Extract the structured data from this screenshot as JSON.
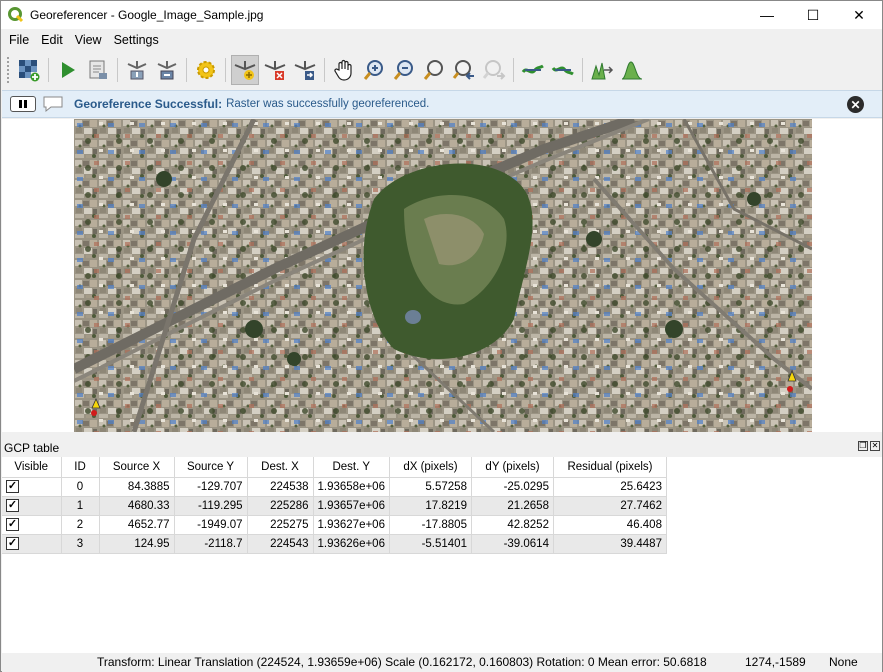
{
  "window": {
    "title": "Georeferencer - Google_Image_Sample.jpg",
    "controls": {
      "minimize": "—",
      "maximize": "☐",
      "close": "✕"
    }
  },
  "menu": [
    "File",
    "Edit",
    "View",
    "Settings"
  ],
  "toolbar": {
    "buttons": [
      "open-raster-icon",
      "start-georeferencing-icon",
      "generate-gdal-script-icon",
      "load-gcp-icon",
      "save-gcp-icon",
      "transformation-settings-icon",
      "add-point-icon",
      "delete-point-icon",
      "move-point-icon",
      "pan-icon",
      "zoom-in-icon",
      "zoom-out-icon",
      "zoom-to-layer-icon",
      "zoom-last-icon",
      "zoom-next-icon",
      "link-georef-to-qgis-icon",
      "link-qgis-to-georef-icon",
      "full-histogram-stretch-icon",
      "local-histogram-stretch-icon"
    ]
  },
  "message": {
    "title": "Georeference Successful:",
    "text": "Raster was successfully georeferenced."
  },
  "gcp": {
    "panel_title": "GCP table",
    "columns": [
      "Visible",
      "ID",
      "Source X",
      "Source Y",
      "Dest. X",
      "Dest. Y",
      "dX (pixels)",
      "dY (pixels)",
      "Residual (pixels)"
    ],
    "rows": [
      {
        "visible": true,
        "id": "0",
        "source_x": "84.3885",
        "source_y": "-129.707",
        "dest_x": "224538",
        "dest_y": "1.93658e+06",
        "dx": "5.57258",
        "dy": "-25.0295",
        "residual": "25.6423"
      },
      {
        "visible": true,
        "id": "1",
        "source_x": "4680.33",
        "source_y": "-119.295",
        "dest_x": "225286",
        "dest_y": "1.93657e+06",
        "dx": "17.8219",
        "dy": "21.2658",
        "residual": "27.7462"
      },
      {
        "visible": true,
        "id": "2",
        "source_x": "4652.77",
        "source_y": "-1949.07",
        "dest_x": "225275",
        "dest_y": "1.93627e+06",
        "dx": "-17.8805",
        "dy": "42.8252",
        "residual": "46.408"
      },
      {
        "visible": true,
        "id": "3",
        "source_x": "124.95",
        "source_y": "-2118.7",
        "dest_x": "224543",
        "dest_y": "1.93626e+06",
        "dx": "-5.51401",
        "dy": "-39.0614",
        "residual": "39.4487"
      }
    ]
  },
  "status": {
    "transform": "Transform: Linear Translation (224524, 1.93659e+06) Scale (0.162172, 0.160803) Rotation: 0 Mean error: 50.6818",
    "coords": "1274,-1589",
    "crs": "None"
  },
  "colors": {
    "accent": "#2a5a8a",
    "message_bg": "#e3eef8",
    "qgis_green": "#589632",
    "marker_yellow": "#f5d60a",
    "marker_red": "#d11a1a"
  }
}
